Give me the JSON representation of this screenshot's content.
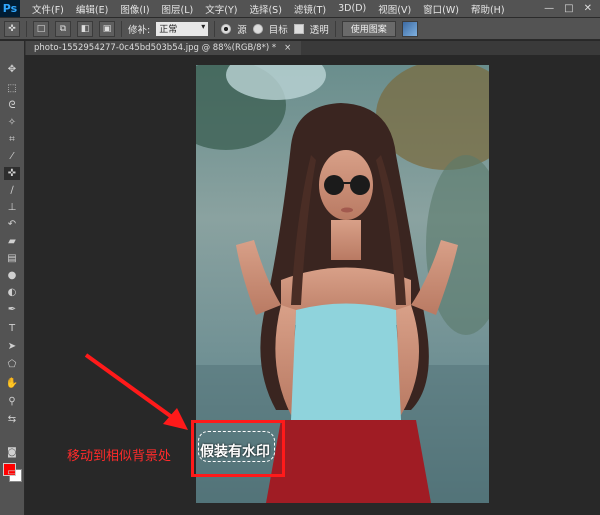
{
  "app": {
    "logo": "Ps"
  },
  "menu": [
    {
      "label": "文件(F)"
    },
    {
      "label": "编辑(E)"
    },
    {
      "label": "图像(I)"
    },
    {
      "label": "图层(L)"
    },
    {
      "label": "文字(Y)"
    },
    {
      "label": "选择(S)"
    },
    {
      "label": "滤镜(T)"
    },
    {
      "label": "3D(D)"
    },
    {
      "label": "视图(V)"
    },
    {
      "label": "窗口(W)"
    },
    {
      "label": "帮助(H)"
    }
  ],
  "window_controls": [
    "—",
    "□",
    "✕"
  ],
  "options": {
    "mode_label": "修补:",
    "mode_value": "正常",
    "source_label": "源",
    "dest_label": "目标",
    "transparent_label": "透明",
    "use_pattern_label": "使用图案"
  },
  "document": {
    "tab_title": "photo-1552954277-0c45bd503b54.jpg @ 88%(RGB/8*) *",
    "close": "×"
  },
  "tools": [
    "move-icon",
    "marquee-icon",
    "lasso-icon",
    "quick-select-icon",
    "crop-icon",
    "eyedropper-icon",
    "patch-icon",
    "brush-icon",
    "clone-stamp-icon",
    "history-brush-icon",
    "eraser-icon",
    "gradient-icon",
    "blur-icon",
    "dodge-icon",
    "pen-icon",
    "type-icon",
    "path-select-icon",
    "shape-icon",
    "hand-icon",
    "zoom-icon"
  ],
  "colors": {
    "foreground": "#ff0000",
    "background": "#ffffff",
    "annotation": "#ff2b2b"
  },
  "annotation": {
    "text": "移动到相似背景处"
  },
  "watermark": {
    "text": "假装有水印"
  }
}
